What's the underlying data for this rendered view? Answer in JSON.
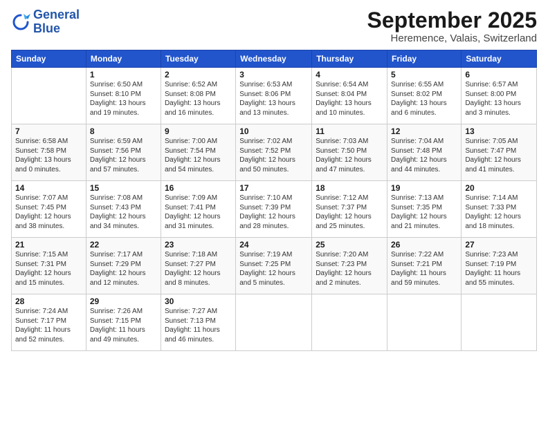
{
  "logo": {
    "line1": "General",
    "line2": "Blue"
  },
  "title": "September 2025",
  "subtitle": "Heremence, Valais, Switzerland",
  "days_of_week": [
    "Sunday",
    "Monday",
    "Tuesday",
    "Wednesday",
    "Thursday",
    "Friday",
    "Saturday"
  ],
  "weeks": [
    [
      {
        "day": "",
        "info": ""
      },
      {
        "day": "1",
        "info": "Sunrise: 6:50 AM\nSunset: 8:10 PM\nDaylight: 13 hours\nand 19 minutes."
      },
      {
        "day": "2",
        "info": "Sunrise: 6:52 AM\nSunset: 8:08 PM\nDaylight: 13 hours\nand 16 minutes."
      },
      {
        "day": "3",
        "info": "Sunrise: 6:53 AM\nSunset: 8:06 PM\nDaylight: 13 hours\nand 13 minutes."
      },
      {
        "day": "4",
        "info": "Sunrise: 6:54 AM\nSunset: 8:04 PM\nDaylight: 13 hours\nand 10 minutes."
      },
      {
        "day": "5",
        "info": "Sunrise: 6:55 AM\nSunset: 8:02 PM\nDaylight: 13 hours\nand 6 minutes."
      },
      {
        "day": "6",
        "info": "Sunrise: 6:57 AM\nSunset: 8:00 PM\nDaylight: 13 hours\nand 3 minutes."
      }
    ],
    [
      {
        "day": "7",
        "info": "Sunrise: 6:58 AM\nSunset: 7:58 PM\nDaylight: 13 hours\nand 0 minutes."
      },
      {
        "day": "8",
        "info": "Sunrise: 6:59 AM\nSunset: 7:56 PM\nDaylight: 12 hours\nand 57 minutes."
      },
      {
        "day": "9",
        "info": "Sunrise: 7:00 AM\nSunset: 7:54 PM\nDaylight: 12 hours\nand 54 minutes."
      },
      {
        "day": "10",
        "info": "Sunrise: 7:02 AM\nSunset: 7:52 PM\nDaylight: 12 hours\nand 50 minutes."
      },
      {
        "day": "11",
        "info": "Sunrise: 7:03 AM\nSunset: 7:50 PM\nDaylight: 12 hours\nand 47 minutes."
      },
      {
        "day": "12",
        "info": "Sunrise: 7:04 AM\nSunset: 7:48 PM\nDaylight: 12 hours\nand 44 minutes."
      },
      {
        "day": "13",
        "info": "Sunrise: 7:05 AM\nSunset: 7:47 PM\nDaylight: 12 hours\nand 41 minutes."
      }
    ],
    [
      {
        "day": "14",
        "info": "Sunrise: 7:07 AM\nSunset: 7:45 PM\nDaylight: 12 hours\nand 38 minutes."
      },
      {
        "day": "15",
        "info": "Sunrise: 7:08 AM\nSunset: 7:43 PM\nDaylight: 12 hours\nand 34 minutes."
      },
      {
        "day": "16",
        "info": "Sunrise: 7:09 AM\nSunset: 7:41 PM\nDaylight: 12 hours\nand 31 minutes."
      },
      {
        "day": "17",
        "info": "Sunrise: 7:10 AM\nSunset: 7:39 PM\nDaylight: 12 hours\nand 28 minutes."
      },
      {
        "day": "18",
        "info": "Sunrise: 7:12 AM\nSunset: 7:37 PM\nDaylight: 12 hours\nand 25 minutes."
      },
      {
        "day": "19",
        "info": "Sunrise: 7:13 AM\nSunset: 7:35 PM\nDaylight: 12 hours\nand 21 minutes."
      },
      {
        "day": "20",
        "info": "Sunrise: 7:14 AM\nSunset: 7:33 PM\nDaylight: 12 hours\nand 18 minutes."
      }
    ],
    [
      {
        "day": "21",
        "info": "Sunrise: 7:15 AM\nSunset: 7:31 PM\nDaylight: 12 hours\nand 15 minutes."
      },
      {
        "day": "22",
        "info": "Sunrise: 7:17 AM\nSunset: 7:29 PM\nDaylight: 12 hours\nand 12 minutes."
      },
      {
        "day": "23",
        "info": "Sunrise: 7:18 AM\nSunset: 7:27 PM\nDaylight: 12 hours\nand 8 minutes."
      },
      {
        "day": "24",
        "info": "Sunrise: 7:19 AM\nSunset: 7:25 PM\nDaylight: 12 hours\nand 5 minutes."
      },
      {
        "day": "25",
        "info": "Sunrise: 7:20 AM\nSunset: 7:23 PM\nDaylight: 12 hours\nand 2 minutes."
      },
      {
        "day": "26",
        "info": "Sunrise: 7:22 AM\nSunset: 7:21 PM\nDaylight: 11 hours\nand 59 minutes."
      },
      {
        "day": "27",
        "info": "Sunrise: 7:23 AM\nSunset: 7:19 PM\nDaylight: 11 hours\nand 55 minutes."
      }
    ],
    [
      {
        "day": "28",
        "info": "Sunrise: 7:24 AM\nSunset: 7:17 PM\nDaylight: 11 hours\nand 52 minutes."
      },
      {
        "day": "29",
        "info": "Sunrise: 7:26 AM\nSunset: 7:15 PM\nDaylight: 11 hours\nand 49 minutes."
      },
      {
        "day": "30",
        "info": "Sunrise: 7:27 AM\nSunset: 7:13 PM\nDaylight: 11 hours\nand 46 minutes."
      },
      {
        "day": "",
        "info": ""
      },
      {
        "day": "",
        "info": ""
      },
      {
        "day": "",
        "info": ""
      },
      {
        "day": "",
        "info": ""
      }
    ]
  ]
}
